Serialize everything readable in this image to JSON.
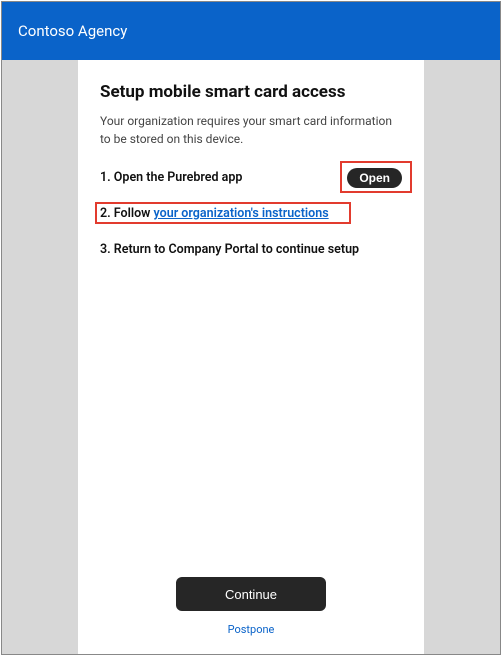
{
  "header": {
    "org_name": "Contoso Agency"
  },
  "main": {
    "title": "Setup mobile smart card access",
    "subtitle": "Your organization requires your smart card information to be stored on this device.",
    "steps": {
      "s1_prefix": "1.  Open the Purebred app",
      "s1_button": "Open",
      "s2_prefix": "2.  Follow ",
      "s2_link": "your organization's instructions",
      "s3_prefix": "3.  Return to Company Portal to continue setup"
    }
  },
  "footer": {
    "continue_label": "Continue",
    "postpone_label": "Postpone"
  }
}
